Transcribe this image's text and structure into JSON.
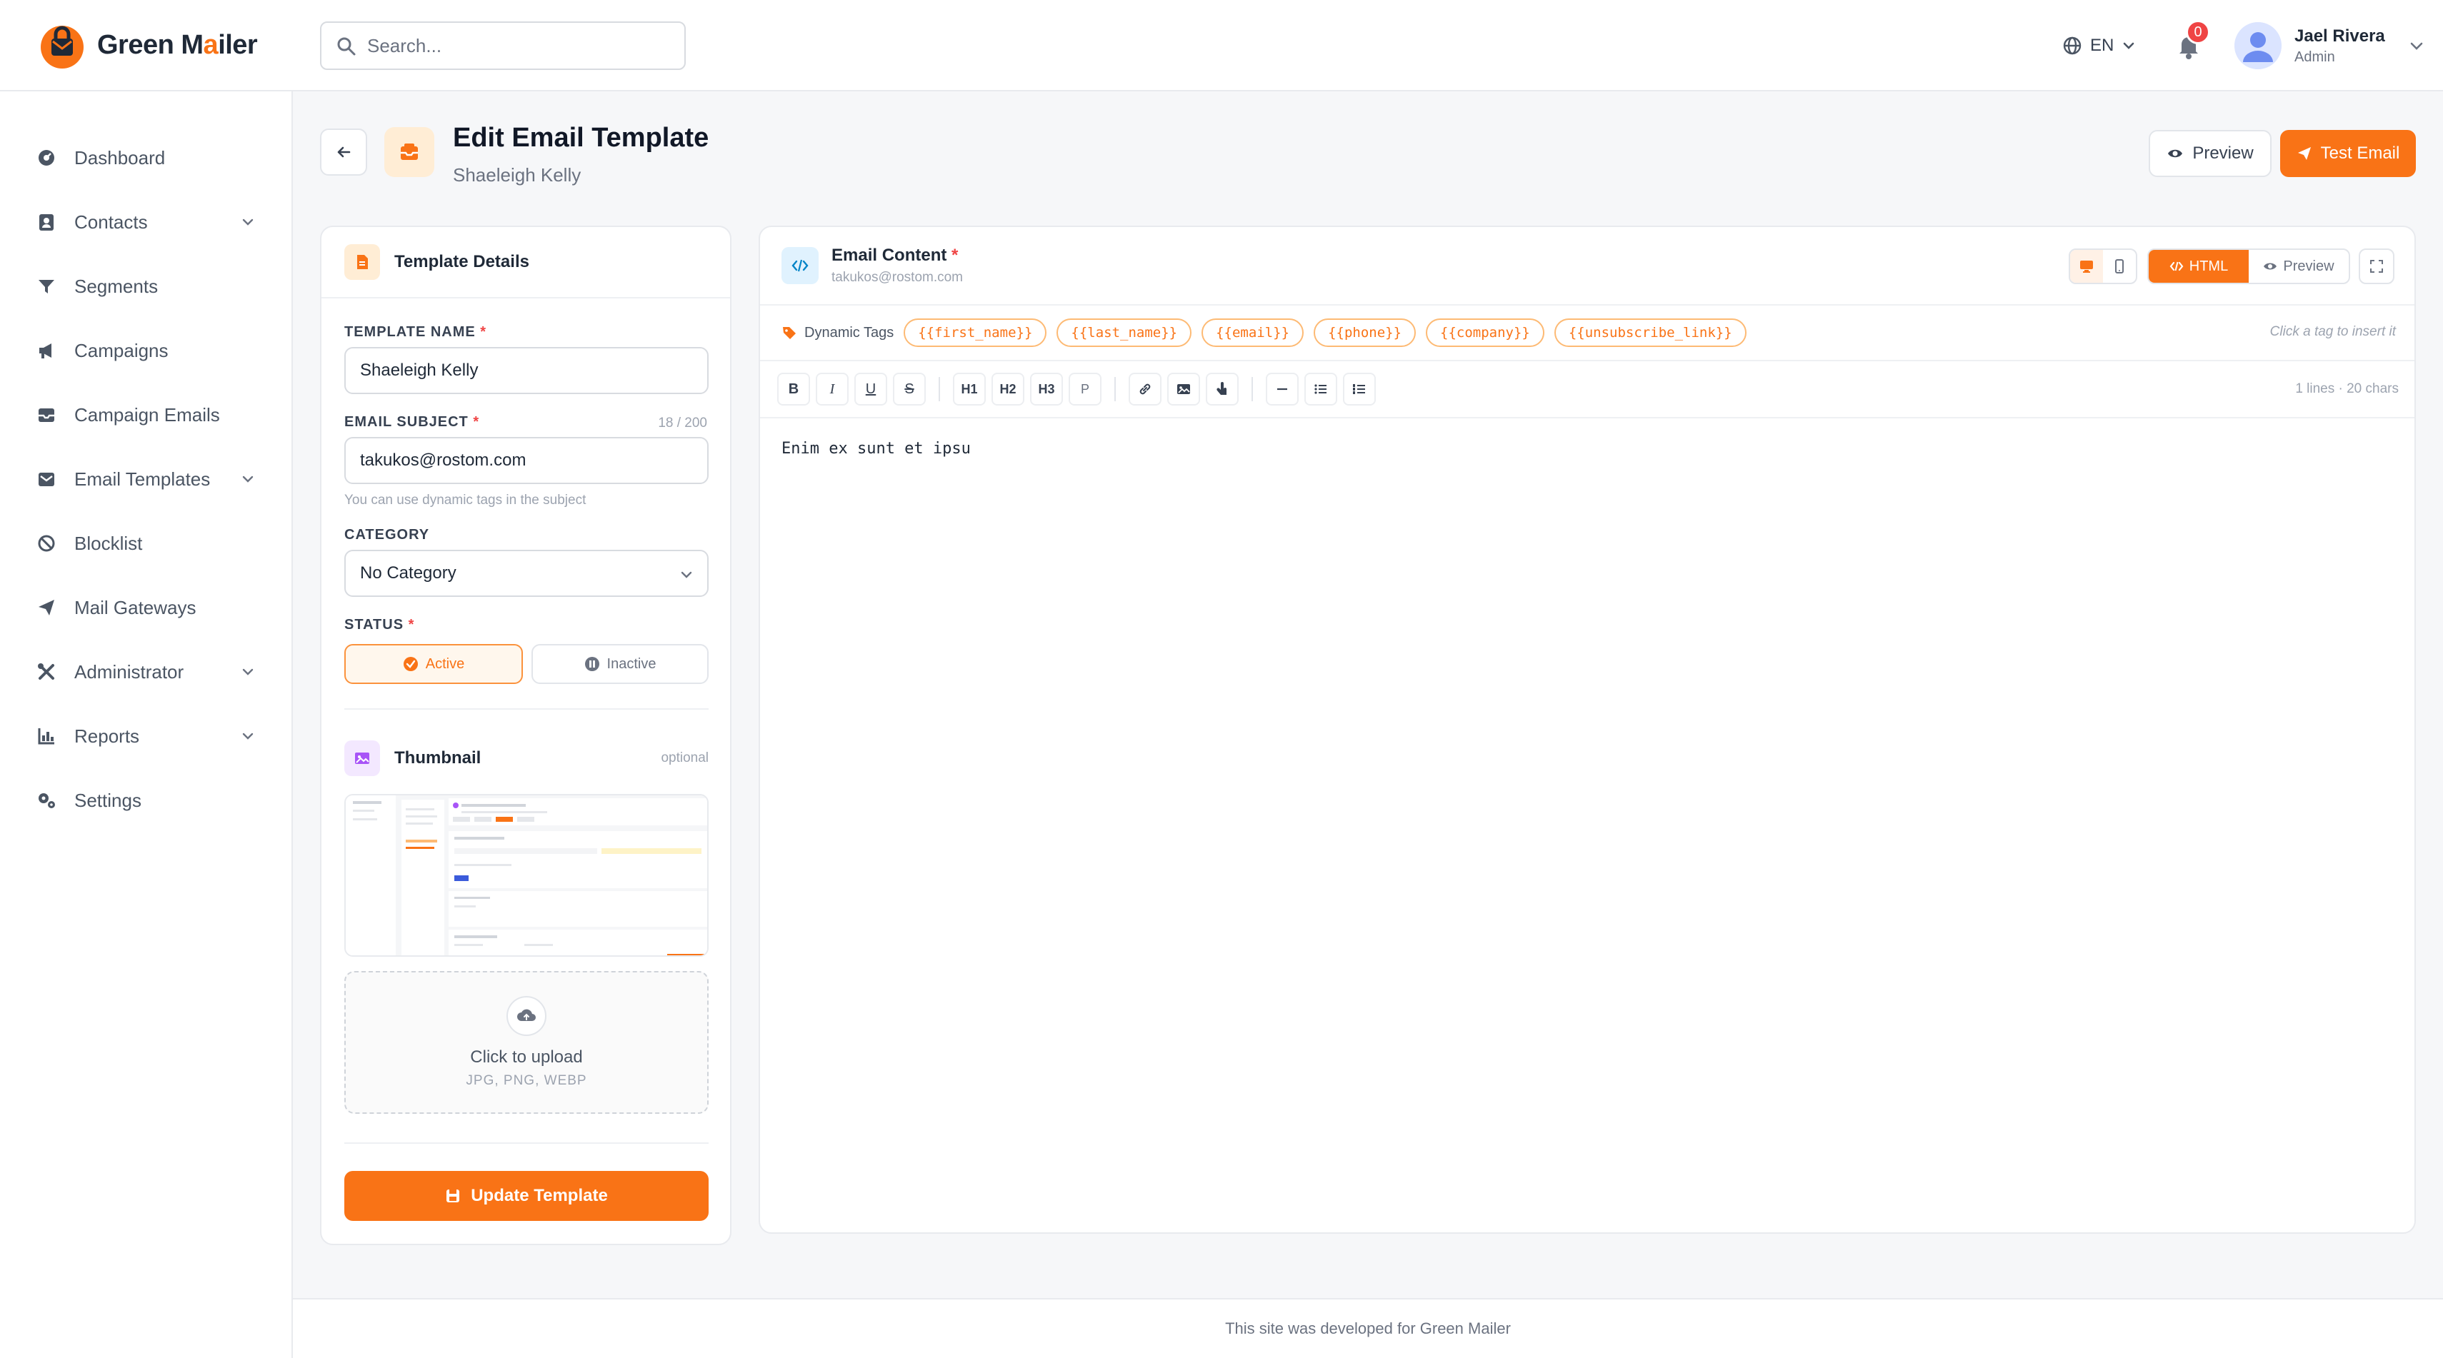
{
  "brand": {
    "name_part1": "Green M",
    "name_accent": "a",
    "name_part2": "iler"
  },
  "search": {
    "placeholder": "Search..."
  },
  "header": {
    "language": "EN",
    "notifications_count": "0",
    "user_name": "Jael Rivera",
    "user_role": "Admin"
  },
  "sidebar": {
    "items": [
      {
        "label": "Dashboard",
        "icon": "dashboard-icon",
        "has_submenu": false
      },
      {
        "label": "Contacts",
        "icon": "contacts-icon",
        "has_submenu": true
      },
      {
        "label": "Segments",
        "icon": "filter-icon",
        "has_submenu": false
      },
      {
        "label": "Campaigns",
        "icon": "megaphone-icon",
        "has_submenu": false
      },
      {
        "label": "Campaign Emails",
        "icon": "inbox-icon",
        "has_submenu": false
      },
      {
        "label": "Email Templates",
        "icon": "template-icon",
        "has_submenu": true
      },
      {
        "label": "Blocklist",
        "icon": "ban-icon",
        "has_submenu": false
      },
      {
        "label": "Mail Gateways",
        "icon": "send-icon",
        "has_submenu": false
      },
      {
        "label": "Administrator",
        "icon": "tools-icon",
        "has_submenu": true
      },
      {
        "label": "Reports",
        "icon": "chart-icon",
        "has_submenu": true
      },
      {
        "label": "Settings",
        "icon": "gears-icon",
        "has_submenu": false
      }
    ]
  },
  "page": {
    "title": "Edit Email Template",
    "subtitle": "Shaeleigh Kelly",
    "preview_label": "Preview",
    "test_email_label": "Test Email"
  },
  "details": {
    "title": "Template Details",
    "template_name_label": "TEMPLATE NAME",
    "template_name_value": "Shaeleigh Kelly",
    "subject_label": "EMAIL SUBJECT",
    "subject_count": "18 / 200",
    "subject_value": "takukos@rostom.com",
    "subject_hint": "You can use dynamic tags in the subject",
    "category_label": "CATEGORY",
    "category_value": "No Category",
    "status_label": "STATUS",
    "status_active": "Active",
    "status_inactive": "Inactive",
    "status_selected": "Active",
    "thumbnail_title": "Thumbnail",
    "thumbnail_optional": "optional",
    "upload_title": "Click to upload",
    "upload_types": "JPG, PNG, WEBP",
    "update_label": "Update Template"
  },
  "editor": {
    "title": "Email Content",
    "subtitle": "takukos@rostom.com",
    "mode_html": "HTML",
    "mode_preview": "Preview",
    "device_selected": "desktop",
    "mode_selected": "HTML",
    "tags_label": "Dynamic Tags",
    "tags": [
      "{{first_name}}",
      "{{last_name}}",
      "{{email}}",
      "{{phone}}",
      "{{company}}",
      "{{unsubscribe_link}}"
    ],
    "tags_hint": "Click a tag to insert it",
    "toolbar": [
      "B",
      "I",
      "U",
      "S",
      "H1",
      "H2",
      "H3",
      "P"
    ],
    "counter": "1 lines · 20 chars",
    "content": "Enim ex sunt et ipsu"
  },
  "footer": {
    "text": "This site was developed for Green Mailer"
  },
  "colors": {
    "accent": "#f97316",
    "accent_soft": "#ffedd5",
    "danger": "#ef4444"
  }
}
